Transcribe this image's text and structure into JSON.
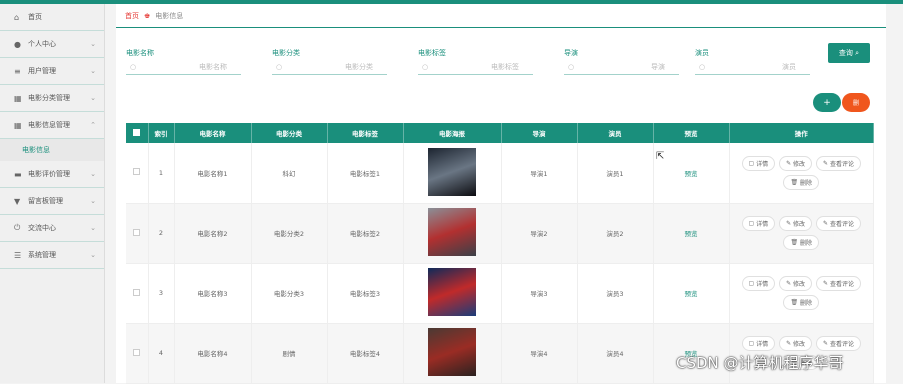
{
  "sidebar": {
    "items": [
      {
        "icon": "home-icon",
        "label": "首页"
      },
      {
        "icon": "user-icon",
        "label": "个人中心"
      },
      {
        "icon": "sliders-icon",
        "label": "用户管理"
      },
      {
        "icon": "film-icon",
        "label": "电影分类管理"
      },
      {
        "icon": "grid-icon",
        "label": "电影信息管理"
      },
      {
        "icon": "monitor-icon",
        "label": "电影评价管理"
      },
      {
        "icon": "board-icon",
        "label": "留言板管理"
      },
      {
        "icon": "power-icon",
        "label": "交流中心"
      },
      {
        "icon": "settings-icon",
        "label": "系统管理"
      }
    ],
    "sub_item": "电影信息"
  },
  "breadcrumb": {
    "home": "首页",
    "current": "电影信息"
  },
  "filters": [
    {
      "label": "电影名称",
      "placeholder": "电影名称"
    },
    {
      "label": "电影分类",
      "placeholder": "电影分类"
    },
    {
      "label": "电影标签",
      "placeholder": "电影标签"
    },
    {
      "label": "导演",
      "placeholder": "导演"
    },
    {
      "label": "演员",
      "placeholder": "演员"
    }
  ],
  "buttons": {
    "search": "查询 ⌕",
    "add": "+",
    "delete": "删"
  },
  "table": {
    "headers": [
      "索引",
      "电影名称",
      "电影分类",
      "电影标签",
      "电影海报",
      "导演",
      "演员",
      "预览",
      "操作"
    ],
    "rows": [
      {
        "index": "1",
        "name": "电影名称1",
        "category": "科幻",
        "tag": "电影标签1",
        "director": "导演1",
        "actor": "演员1",
        "preview": "预览",
        "poster_colors": [
          "#1c2430",
          "#6a7684",
          "#0c0c10"
        ]
      },
      {
        "index": "2",
        "name": "电影名称2",
        "category": "电影分类2",
        "tag": "电影标签2",
        "director": "导演2",
        "actor": "演员2",
        "preview": "预览",
        "poster_colors": [
          "#8a9098",
          "#b23030",
          "#3a4048"
        ]
      },
      {
        "index": "3",
        "name": "电影名称3",
        "category": "电影分类3",
        "tag": "电影标签3",
        "director": "导演3",
        "actor": "演员3",
        "preview": "预览",
        "poster_colors": [
          "#0e2a5a",
          "#c02a2a",
          "#1a3c7a"
        ]
      },
      {
        "index": "4",
        "name": "电影名称4",
        "category": "剧情",
        "tag": "电影标签4",
        "director": "导演4",
        "actor": "演员4",
        "preview": "预览",
        "poster_colors": [
          "#4a3a34",
          "#9a2c24",
          "#2a2220"
        ]
      }
    ],
    "actions": {
      "detail": "详情",
      "edit": "修改",
      "view_reviews": "查看评论",
      "delete": "删除"
    }
  },
  "watermark": "CSDN @计算机程序华哥",
  "colors": {
    "accent": "#1a8f7c",
    "danger": "#f0561d",
    "breadcrumb_home": "#e53935"
  }
}
